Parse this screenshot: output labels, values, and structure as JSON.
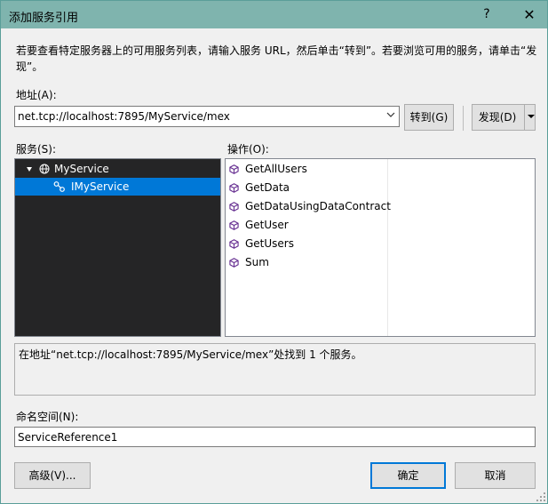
{
  "window": {
    "title": "添加服务引用",
    "help_label": "?",
    "close_label": "✕"
  },
  "description": "若要查看特定服务器上的可用服务列表，请输入服务 URL，然后单击“转到”。若要浏览可用的服务，请单击“发现”。",
  "address": {
    "label": "地址(A):",
    "value": "net.tcp://localhost:7895/MyService/mex"
  },
  "buttons": {
    "go": "转到(G)",
    "discover": "发现(D)",
    "advanced": "高级(V)...",
    "ok": "确定",
    "cancel": "取消"
  },
  "services": {
    "label": "服务(S):",
    "items": [
      {
        "name": "MyService",
        "icon": "globe-icon",
        "expanded": true
      },
      {
        "name": "IMyService",
        "icon": "interface-icon",
        "selected": true
      }
    ]
  },
  "operations": {
    "label": "操作(O):",
    "items": [
      "GetAllUsers",
      "GetData",
      "GetDataUsingDataContract",
      "GetUser",
      "GetUsers",
      "Sum"
    ],
    "icon": "method-icon",
    "icon_color": "#652d90"
  },
  "status": "在地址“net.tcp://localhost:7895/MyService/mex”处找到 1 个服务。",
  "namespace": {
    "label": "命名空间(N):",
    "value": "ServiceReference1"
  },
  "colors": {
    "titlebar": "#7fb4ae",
    "tree_bg": "#252526",
    "selection": "#0078d7",
    "accent": "#0078d7"
  }
}
